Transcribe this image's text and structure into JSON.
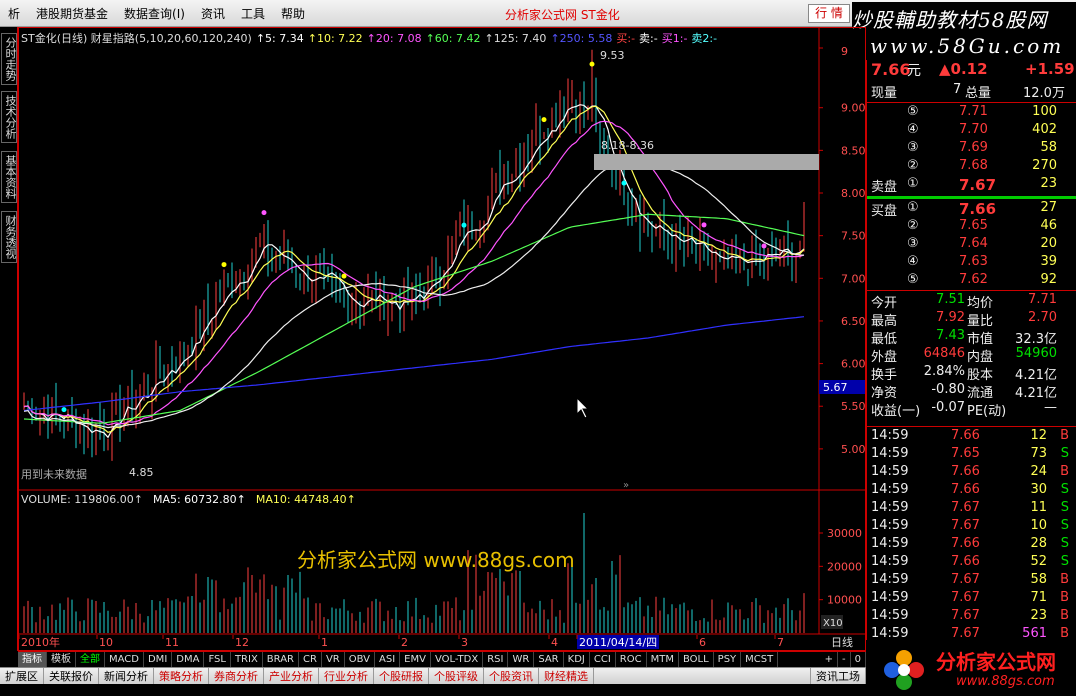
{
  "menubar": {
    "items": [
      "析",
      "港股期货基金",
      "数据查询(I)",
      "资讯",
      "工具",
      "帮助"
    ],
    "app_title": "分析家公式网 ST金化",
    "quote_button": "行 情"
  },
  "watermark": {
    "line1": "炒股輔助教材58股网",
    "line2": "www.58Gu.com"
  },
  "left_tabs": [
    "分时走势",
    "技术分析",
    "基本资料",
    "财务透视"
  ],
  "chart": {
    "title_items": [
      {
        "text": "ST金化(日线) 财星指路(5,10,20,60,120,240)",
        "color": "#dddddd"
      },
      {
        "text": "↑5: 7.34",
        "color": "#ffffff"
      },
      {
        "text": "↑10: 7.22",
        "color": "#ffff55"
      },
      {
        "text": "↑20: 7.08",
        "color": "#ff55ff"
      },
      {
        "text": "↑60: 7.42",
        "color": "#55ff55"
      },
      {
        "text": "↑125: 7.40",
        "color": "#dddddd"
      },
      {
        "text": "↑250: 5.58",
        "color": "#5555ff"
      },
      {
        "text": "买:-",
        "color": "#ff4444"
      },
      {
        "text": "卖:-",
        "color": "#ffffff"
      },
      {
        "text": "买1:-",
        "color": "#ff55ff"
      },
      {
        "text": "卖2:-",
        "color": "#55ffff"
      }
    ],
    "y_ticks": [
      "9",
      "9.00",
      "8.50",
      "8.00",
      "7.50",
      "7.00",
      "6.50",
      "6.00",
      "5.50",
      "5.00"
    ],
    "price_high_label": "9.53",
    "price_low_label": "4.85",
    "band_label": "8.18-8.36",
    "current_price_tag": "5.67",
    "footer_note": "用到未来数据",
    "volume_title": [
      "VOLUME: 119806.00↑",
      "MA5: 60732.80↑",
      "MA10: 44748.40↑"
    ],
    "volume_ticks": [
      "30000",
      "20000",
      "10000"
    ],
    "volume_unit": "X10",
    "x_labels": [
      "2010年",
      "10",
      "11",
      "12",
      "1",
      "2",
      "3",
      "4",
      "2011/04/14/四",
      "6",
      "7"
    ],
    "period_label": "日线",
    "overlay_watermark": "分析家公式网 www.88gs.com",
    "scroll_marker": "»"
  },
  "chart_data": {
    "type": "line",
    "title": "ST金化(日线)",
    "ylim": [
      4.6,
      9.7
    ],
    "series": [
      {
        "name": "250",
        "values": [
          5.45,
          5.55,
          5.67,
          5.75,
          5.85,
          5.95,
          6.05,
          6.2,
          6.3,
          6.45,
          6.55
        ]
      },
      {
        "name": "60",
        "values": [
          5.35,
          5.3,
          5.45,
          5.9,
          6.4,
          6.9,
          7.2,
          7.6,
          7.75,
          7.7,
          7.5
        ]
      },
      {
        "name": "5",
        "values": [
          5.5,
          5.2,
          6.1,
          7.4,
          6.8,
          6.7,
          8.0,
          9.2,
          7.6,
          7.1,
          7.34
        ]
      }
    ],
    "volume_max": 39000
  },
  "bottom_tabs": [
    "指标",
    "模板",
    "全部",
    "MACD",
    "DMI",
    "DMA",
    "FSL",
    "TRIX",
    "BRAR",
    "CR",
    "VR",
    "OBV",
    "ASI",
    "EMV",
    "VOL-TDX",
    "RSI",
    "WR",
    "SAR",
    "KDJ",
    "CCI",
    "ROC",
    "MTM",
    "BOLL",
    "PSY",
    "MCST"
  ],
  "bottom_right": [
    "+",
    "-",
    "0"
  ],
  "status_items": [
    "扩展区",
    "关联报价",
    "新闻分析",
    "策略分析",
    "券商分析",
    "产业分析",
    "行业分析",
    "个股研报",
    "个股评级",
    "个股资讯",
    "财经精选"
  ],
  "status_right": "资讯工场",
  "quote": {
    "price": "7.66",
    "unit": "元",
    "change": "▲0.12",
    "pct": "+1.59",
    "now_label": "现量",
    "now_vol": "7",
    "total_label": "总量",
    "total_vol": "12.0万",
    "asks": [
      {
        "lvl": "⑤",
        "price": "7.71",
        "vol": "100"
      },
      {
        "lvl": "④",
        "price": "7.70",
        "vol": "402"
      },
      {
        "lvl": "③",
        "price": "7.69",
        "vol": "58"
      },
      {
        "lvl": "②",
        "price": "7.68",
        "vol": "270"
      },
      {
        "lvl": "①",
        "price": "7.67",
        "vol": "23",
        "label": "卖盘"
      }
    ],
    "bids": [
      {
        "lvl": "①",
        "price": "7.66",
        "vol": "27",
        "label": "买盘"
      },
      {
        "lvl": "②",
        "price": "7.65",
        "vol": "46"
      },
      {
        "lvl": "③",
        "price": "7.64",
        "vol": "20"
      },
      {
        "lvl": "④",
        "price": "7.63",
        "vol": "39"
      },
      {
        "lvl": "⑤",
        "price": "7.62",
        "vol": "92"
      }
    ],
    "stats": [
      {
        "k1": "今开",
        "v1": "7.51",
        "c1": "grn",
        "k2": "均价",
        "v2": "7.71",
        "c2": "red"
      },
      {
        "k1": "最高",
        "v1": "7.92",
        "c1": "red",
        "k2": "量比",
        "v2": "2.70",
        "c2": "red"
      },
      {
        "k1": "最低",
        "v1": "7.43",
        "c1": "grn",
        "k2": "市值",
        "v2": "32.3亿",
        "c2": "wht"
      },
      {
        "k1": "外盘",
        "v1": "64846",
        "c1": "red",
        "k2": "内盘",
        "v2": "54960",
        "c2": "grn"
      },
      {
        "k1": "换手",
        "v1": "2.84%",
        "c1": "wht",
        "k2": "股本",
        "v2": "4.21亿",
        "c2": "wht"
      },
      {
        "k1": "净资",
        "v1": "-0.80",
        "c1": "wht",
        "k2": "流通",
        "v2": "4.21亿",
        "c2": "wht"
      },
      {
        "k1": "收益(一)",
        "v1": "-0.07",
        "c1": "wht",
        "k2": "PE(动)",
        "v2": "—",
        "c2": "wht"
      }
    ],
    "ticks": [
      {
        "t": "14:59",
        "p": "7.66",
        "v": "12",
        "s": "B"
      },
      {
        "t": "14:59",
        "p": "7.65",
        "v": "73",
        "s": "S"
      },
      {
        "t": "14:59",
        "p": "7.66",
        "v": "24",
        "s": "B"
      },
      {
        "t": "14:59",
        "p": "7.66",
        "v": "30",
        "s": "S"
      },
      {
        "t": "14:59",
        "p": "7.67",
        "v": "11",
        "s": "S"
      },
      {
        "t": "14:59",
        "p": "7.67",
        "v": "10",
        "s": "S"
      },
      {
        "t": "14:59",
        "p": "7.66",
        "v": "28",
        "s": "S"
      },
      {
        "t": "14:59",
        "p": "7.66",
        "v": "52",
        "s": "S"
      },
      {
        "t": "14:59",
        "p": "7.67",
        "v": "58",
        "s": "B"
      },
      {
        "t": "14:59",
        "p": "7.67",
        "v": "71",
        "s": "B"
      },
      {
        "t": "14:59",
        "p": "7.67",
        "v": "23",
        "s": "B"
      },
      {
        "t": "14:59",
        "p": "7.67",
        "v": "561",
        "s": "B"
      }
    ]
  },
  "logo": {
    "line1": "分析家公式网",
    "line2": "www.88gs.com"
  }
}
